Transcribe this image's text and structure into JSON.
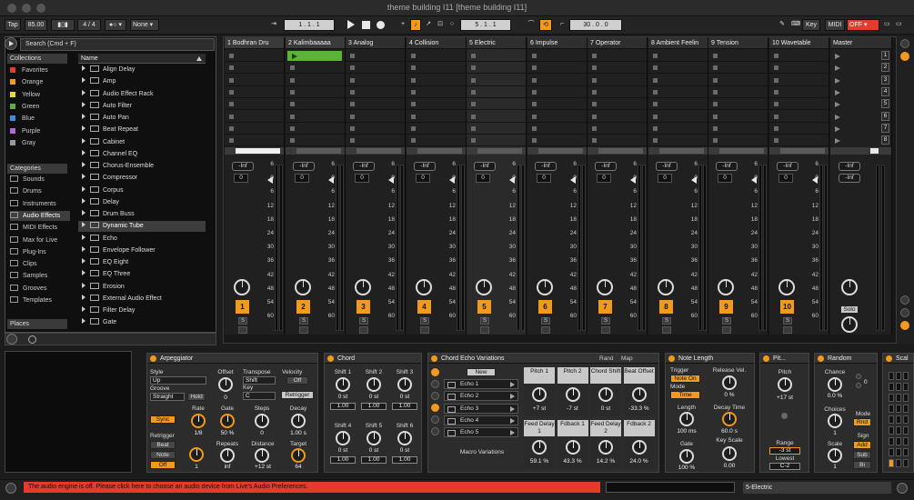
{
  "window": {
    "title": "theme building I11  [theme building I11]"
  },
  "control_bar": {
    "tap": "Tap",
    "tempo": "85.00",
    "signature": "4 / 4",
    "metro_sel": "None",
    "arrangement_pos": "1 .  1 .  1",
    "loop_start": "5 .  1 .  1",
    "loop_length": "30 .  0 .  0",
    "key_btn": "Key",
    "midi_btn": "MIDI",
    "off_btn": "OFF"
  },
  "browser": {
    "search_placeholder": "Search (Cmd + F)",
    "collections_head": "Collections",
    "collections": [
      {
        "label": "Favorites",
        "color": "#e43b2c"
      },
      {
        "label": "Orange",
        "color": "#f29a1d"
      },
      {
        "label": "Yellow",
        "color": "#eadb33"
      },
      {
        "label": "Green",
        "color": "#5cb33a"
      },
      {
        "label": "Blue",
        "color": "#3a8fe0"
      },
      {
        "label": "Purple",
        "color": "#b06ad8"
      },
      {
        "label": "Gray",
        "color": "#9a9a9a"
      }
    ],
    "categories_head": "Categories",
    "categories": [
      "Sounds",
      "Drums",
      "Instruments",
      "Audio Effects",
      "MIDI Effects",
      "Max for Live",
      "Plug-Ins",
      "Clips",
      "Samples",
      "Grooves",
      "Templates"
    ],
    "categories_selected": "Audio Effects",
    "places_head": "Places",
    "name_head": "Name",
    "devices": [
      "Align Delay",
      "Amp",
      "Audio Effect Rack",
      "Auto Filter",
      "Auto Pan",
      "Beat Repeat",
      "Cabinet",
      "Channel EQ",
      "Chorus-Ensemble",
      "Compressor",
      "Corpus",
      "Delay",
      "Drum Buss",
      "Dynamic Tube",
      "Echo",
      "Envelope Follower",
      "EQ Eight",
      "EQ Three",
      "Erosion",
      "External Audio Effect",
      "Filter Delay",
      "Gate"
    ],
    "devices_selected": "Dynamic Tube"
  },
  "tracks": [
    {
      "name": "1 Bodhran Dru",
      "num": "1",
      "group": true
    },
    {
      "name": "2 Kalimbaaaaa",
      "num": "2",
      "group": true,
      "playing": true
    },
    {
      "name": "3 Analog",
      "num": "3"
    },
    {
      "name": "4 Collision",
      "num": "4"
    },
    {
      "name": "5 Electric",
      "num": "5",
      "selected": true
    },
    {
      "name": "6 Impulse",
      "num": "6"
    },
    {
      "name": "7 Operator",
      "num": "7"
    },
    {
      "name": "8 Ambient Feelin",
      "num": "8"
    },
    {
      "name": "9 Tension",
      "num": "9"
    },
    {
      "name": "10 Wavetable",
      "num": "10"
    }
  ],
  "mixer": {
    "inf": "-Inf",
    "zero": "0",
    "s": "S",
    "ticks": [
      "6",
      "0",
      "6",
      "12",
      "18",
      "24",
      "30",
      "36",
      "42",
      "48",
      "54",
      "60"
    ]
  },
  "master": {
    "name": "Master",
    "solo": "Solo",
    "scenes": [
      "1",
      "2",
      "3",
      "4",
      "5",
      "6",
      "7",
      "8"
    ]
  },
  "arpeggiator": {
    "title": "Arpeggiator",
    "style_label": "Style",
    "style_value": "Up",
    "groove_label": "Groove",
    "groove_value": "Straight",
    "hold": "Hold",
    "offset_label": "Offset",
    "offset_value": "0",
    "transpose_label": "Transpose",
    "transpose_value": "Shift",
    "key_label": "Key",
    "key_value": "C",
    "velocity_label": "Velocity",
    "velocity_value": "Off",
    "retrigger_btn": "Retrigger",
    "sync": "Sync",
    "rate_label": "Rate",
    "rate_value": "1/8",
    "gate_label": "Gate",
    "gate_value": "50 %",
    "steps_label": "Steps",
    "steps_value": "0",
    "decay_label": "Decay",
    "decay_value": "1.00 s",
    "retrigger_label": "Retrigger",
    "beat": "Beat",
    "note": "Note",
    "off": "Off",
    "retrig_value": "1",
    "repeats_label": "Repeats",
    "repeats_value": "inf",
    "distance_label": "Distance",
    "distance_value": "+12 st",
    "target_label": "Target",
    "target_value": "64"
  },
  "chord": {
    "title": "Chord",
    "shifts": [
      {
        "label": "Shift 1",
        "value": "0 st",
        "vel": "1.00"
      },
      {
        "label": "Shift 2",
        "value": "0 st",
        "vel": "1.00"
      },
      {
        "label": "Shift 3",
        "value": "0 st",
        "vel": "1.00"
      },
      {
        "label": "Shift 4",
        "value": "0 st",
        "vel": "1.00"
      },
      {
        "label": "Shift 5",
        "value": "0 st",
        "vel": "1.00"
      },
      {
        "label": "Shift 6",
        "value": "0 st",
        "vel": "1.00"
      }
    ]
  },
  "rack": {
    "title": "Chord Echo Variations",
    "rand": "Rand",
    "map": "Map",
    "new_btn": "New",
    "variations": [
      "Echo 1",
      "Echo 2",
      "Echo 3",
      "Echo 4",
      "Echo 5"
    ],
    "macro_label": "Macro Variations",
    "macros": [
      {
        "label": "Pitch 1",
        "value": "+7 st"
      },
      {
        "label": "Pitch 2",
        "value": "-7 st"
      },
      {
        "label": "Chord Shift",
        "value": "0 st"
      },
      {
        "label": "Beat Offset",
        "value": "-33.3 %"
      },
      {
        "label": "Feed Delay 1",
        "value": "59.1 %"
      },
      {
        "label": "Fdback 1",
        "value": "43.3 %"
      },
      {
        "label": "Feed Delay 2",
        "value": "14.2 %"
      },
      {
        "label": "Fdback 2",
        "value": "24.0 %"
      }
    ]
  },
  "note_length": {
    "title": "Note Length",
    "trigger_label": "Trigger",
    "trigger_value": "Note On",
    "mode_label": "Mode",
    "mode_value": "Time",
    "release_label": "Release Vel.",
    "release_value": "0 %",
    "length_label": "Length",
    "length_value": "100 ms",
    "decay_label": "Decay Time",
    "decay_value": "60.0 s",
    "gate_label": "Gate",
    "gate_value": "100 %",
    "keyscale_label": "Key Scale",
    "keyscale_value": "0.00"
  },
  "pitch": {
    "title": "Pit...",
    "pitch_label": "Pitch",
    "pitch_value": "+17 st",
    "range_label": "Range",
    "range_value": "-3 st",
    "lowest_label": "Lowest",
    "lowest_value": "C-2"
  },
  "random": {
    "title": "Random",
    "chance_label": "Chance",
    "chance_value": "0.0 %",
    "choices_label": "Choices",
    "choices_value": "1",
    "scale_label": "Scale",
    "scale_value": "1",
    "mode_label": "Mode",
    "mode_value": "Rnd",
    "sign_label": "Sign",
    "add": "Add",
    "sub": "Sub",
    "bi": "Bi",
    "side_value": "0"
  },
  "scale_dev": {
    "title": "Scal"
  },
  "status": {
    "message": "The audio engine is off. Please click here to choose an audio device from Live's Audio Preferences.",
    "track_name": "5-Electric"
  }
}
